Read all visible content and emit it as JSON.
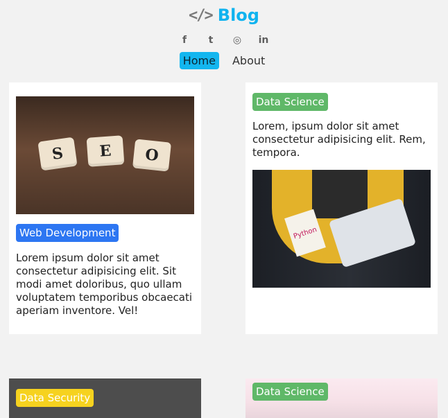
{
  "header": {
    "brand_icon": "</>",
    "brand_title": "Blog",
    "social": [
      {
        "name": "facebook-icon",
        "glyph": "f"
      },
      {
        "name": "twitter-icon",
        "glyph": "t"
      },
      {
        "name": "instagram-icon",
        "glyph": "◎"
      },
      {
        "name": "linkedin-icon",
        "glyph": "in"
      }
    ],
    "nav": {
      "home": "Home",
      "about": "About"
    }
  },
  "posts": [
    {
      "tag": "Web Development",
      "text": "Lorem ipsum dolor sit amet consectetur adipisicing elit. Sit modi amet doloribus, quo ullam voluptatem temporibus obcaecati aperiam inventore. Vel!",
      "image_letters": [
        "S",
        "E",
        "O"
      ]
    },
    {
      "tag": "Data Science",
      "text": "Lorem, ipsum dolor sit amet consectetur adipisicing elit. Rem, tempora.",
      "image_label": "Python"
    },
    {
      "tag": "Data Security"
    },
    {
      "tag": "Data Science"
    }
  ]
}
